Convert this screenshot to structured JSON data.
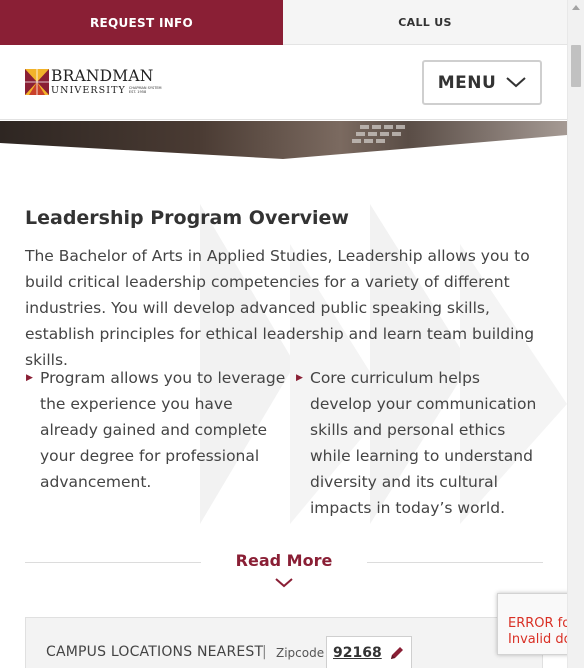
{
  "topbar": {
    "request_info": "REQUEST INFO",
    "call_us": "CALL US"
  },
  "header": {
    "logo_name": "BRANDMAN",
    "logo_univ": "UNIVERSITY",
    "logo_tiny_1": "CHAPMAN SYSTEM",
    "logo_tiny_2": "EST. 1958",
    "menu_label": "MENU"
  },
  "section": {
    "title": "Leadership Program Overview",
    "intro": "The Bachelor of Arts in Applied Studies, Leadership allows you to build critical leadership competencies for a variety of different industries. You will develop advanced public speaking skills, establish principles for ethical leadership and learn team building skills.",
    "bullets": [
      "Program allows you to leverage the experience you have already gained and complete your degree for professional advancement.",
      "Core curriculum helps develop your communication skills and personal ethics while learning to understand diversity and its cultural impacts in today’s world."
    ],
    "read_more": "Read More"
  },
  "campus": {
    "label": "CAMPUS LOCATIONS NEAREST",
    "separator": "|",
    "zip_label": "Zipcode",
    "zip_value": "92168"
  },
  "recaptcha": {
    "line1": "ERROR fo",
    "line2": "Invalid do"
  },
  "colors": {
    "brand": "#8a1f35",
    "logo_gold": "#f2b32a",
    "error": "#d93025"
  },
  "icons": {
    "menu": "chevron-down-icon",
    "bullet": "caret-right-icon",
    "read_more": "chevron-down-icon",
    "zip_edit": "pencil-icon"
  }
}
